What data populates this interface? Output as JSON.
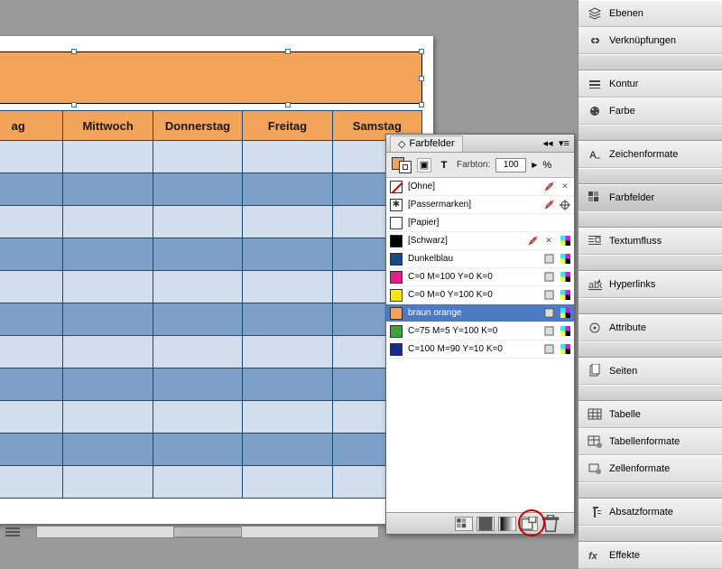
{
  "right_panel_items": [
    {
      "label": "Ebenen",
      "icon": "layers"
    },
    {
      "label": "Verknüpfungen",
      "icon": "links"
    },
    {
      "sep": true
    },
    {
      "label": "Kontur",
      "icon": "stroke"
    },
    {
      "label": "Farbe",
      "icon": "color"
    },
    {
      "sep": true
    },
    {
      "label": "Zeichenformate",
      "icon": "charstyle"
    },
    {
      "sep": true
    },
    {
      "label": "Farbfelder",
      "icon": "swatches",
      "selected": true
    },
    {
      "sep": true
    },
    {
      "label": "Textumfluss",
      "icon": "textwrap"
    },
    {
      "sep": true
    },
    {
      "label": "Hyperlinks",
      "icon": "hyperlink"
    },
    {
      "sep": true
    },
    {
      "label": "Attribute",
      "icon": "attributes"
    },
    {
      "sep": true
    },
    {
      "label": "Seiten",
      "icon": "pages"
    },
    {
      "sep": true
    },
    {
      "label": "Tabelle",
      "icon": "table"
    },
    {
      "label": "Tabellenformate",
      "icon": "tablestyle"
    },
    {
      "label": "Zellenformate",
      "icon": "cellstyle"
    },
    {
      "sep": true
    },
    {
      "label": "Absatzformate",
      "icon": "parastyle"
    },
    {
      "sep": true
    },
    {
      "label": "Effekte",
      "icon": "fx"
    }
  ],
  "table": {
    "columns": [
      "ag",
      "Mittwoch",
      "Donnerstag",
      "Freitag",
      "Samstag"
    ],
    "row_count": 11
  },
  "swatches": {
    "title": "Farbfelder",
    "tint_label": "Farbton:",
    "tint_value": "100",
    "tint_unit": "%",
    "items": [
      {
        "name": "[Ohne]",
        "chip": "none",
        "badges": [
          "pencil",
          "cross"
        ]
      },
      {
        "name": "[Passermarken]",
        "chip": "reg",
        "badges": [
          "pencil",
          "reg"
        ]
      },
      {
        "name": "[Papier]",
        "chip": "#ffffff",
        "badges": []
      },
      {
        "name": "[Schwarz]",
        "chip": "#000000",
        "badges": [
          "pencil",
          "cross",
          "cmyk"
        ]
      },
      {
        "name": "Dunkelblau",
        "chip": "#1a4a8a",
        "badges": [
          "box",
          "cmyk"
        ]
      },
      {
        "name": "C=0 M=100 Y=0 K=0",
        "chip": "#e61a8d",
        "badges": [
          "box",
          "cmyk"
        ]
      },
      {
        "name": "C=0 M=0 Y=100 K=0",
        "chip": "#ffe600",
        "badges": [
          "box",
          "cmyk"
        ]
      },
      {
        "name": "braun orange",
        "chip": "#f2a45b",
        "badges": [
          "box",
          "cmyk"
        ],
        "selected": true
      },
      {
        "name": "C=75 M=5 Y=100 K=0",
        "chip": "#3ba33b",
        "badges": [
          "box",
          "cmyk"
        ]
      },
      {
        "name": "C=100 M=90 Y=10 K=0",
        "chip": "#1a2a9a",
        "badges": [
          "box",
          "cmyk"
        ]
      }
    ]
  }
}
